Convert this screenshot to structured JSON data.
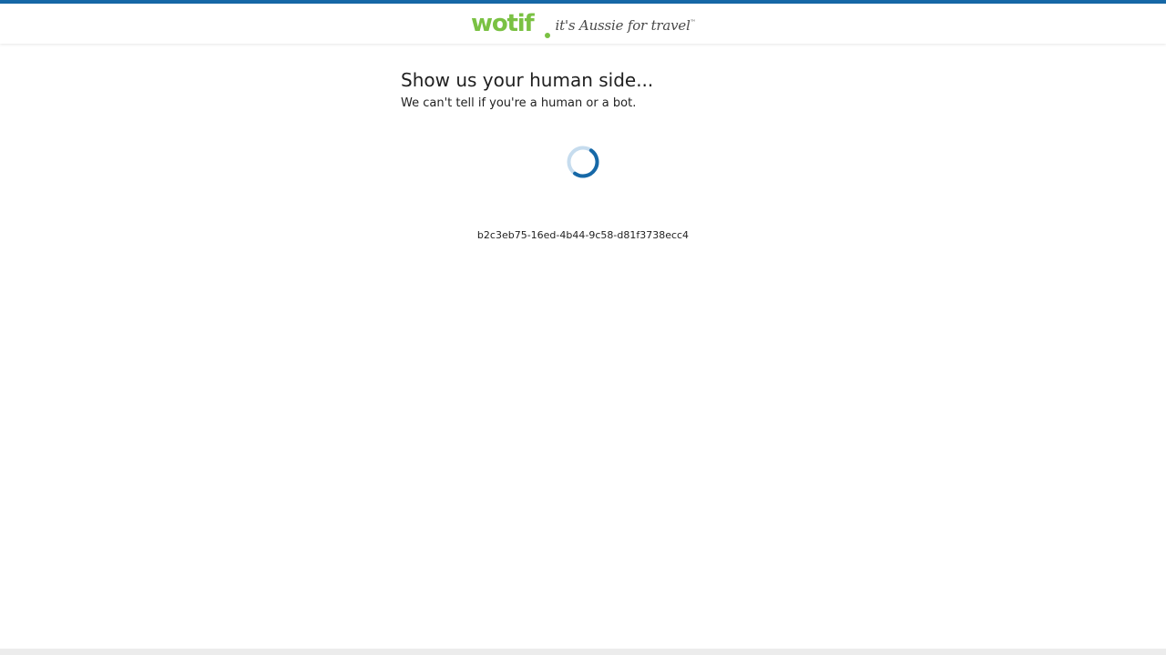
{
  "header": {
    "logo_text": "wotif",
    "tagline": "it's Aussie for travel",
    "trademark": "™"
  },
  "challenge": {
    "title": "Show us your human side...",
    "message": "We can't tell if you're a human or a bot.",
    "reference_id": "b2c3eb75-16ed-4b44-9c58-d81f3738ecc4"
  },
  "icons": {
    "spinner": "loading-spinner-icon"
  },
  "colors": {
    "brand_blue": "#1668a7",
    "brand_green": "#7ac143",
    "spinner_track": "#c6dcee",
    "spinner_arc": "#1668a7"
  }
}
